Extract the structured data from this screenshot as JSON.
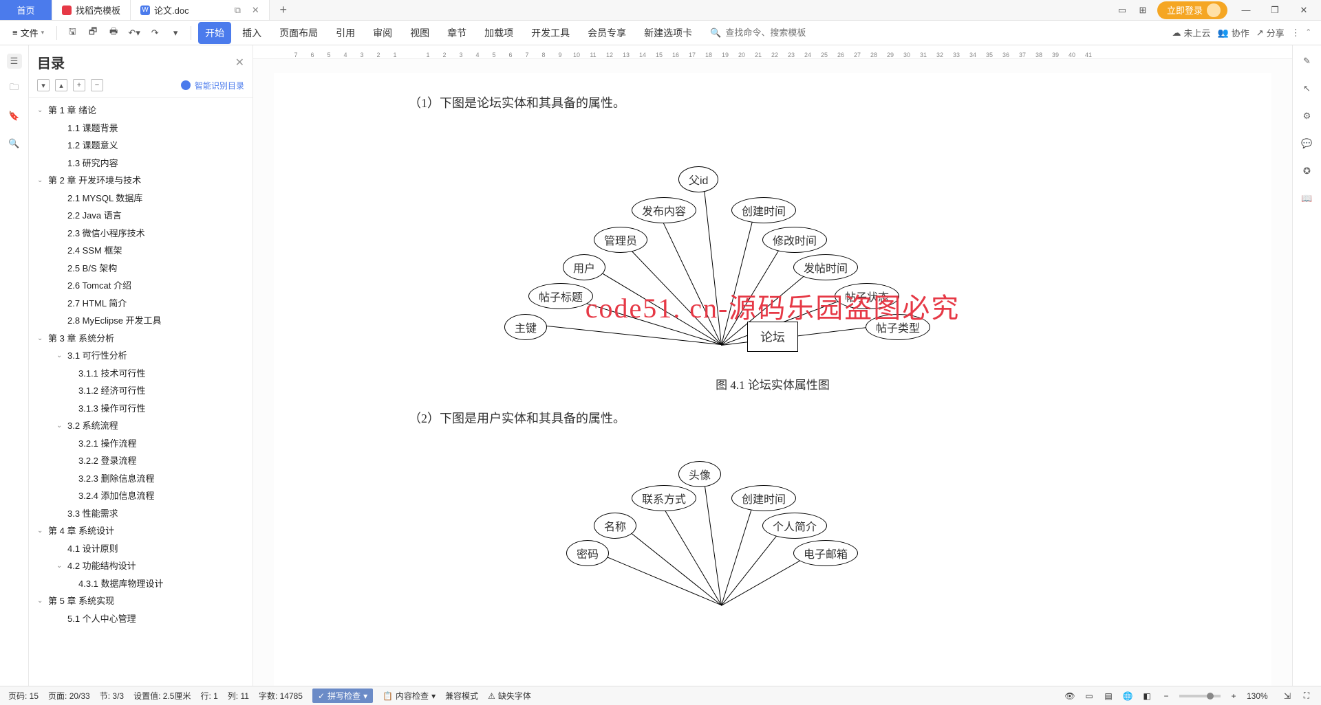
{
  "titlebar": {
    "home": "首页",
    "template_tab": "找稻壳模板",
    "doc_tab": "论文.doc",
    "login": "立即登录"
  },
  "toolbar": {
    "file_menu": "文件",
    "ribbon": [
      "开始",
      "插入",
      "页面布局",
      "引用",
      "审阅",
      "视图",
      "章节",
      "加载项",
      "开发工具",
      "会员专享",
      "新建选项卡"
    ],
    "search_placeholder": "查找命令、搜索模板",
    "cloud": "未上云",
    "collab": "协作",
    "share": "分享"
  },
  "outline": {
    "title": "目录",
    "smart": "智能识别目录",
    "items": [
      {
        "level": 1,
        "chev": true,
        "text": "第 1 章  绪论"
      },
      {
        "level": 2,
        "text": "1.1  课题背景"
      },
      {
        "level": 2,
        "text": "1.2  课题意义"
      },
      {
        "level": 2,
        "text": "1.3  研究内容"
      },
      {
        "level": 1,
        "chev": true,
        "text": "第 2 章  开发环境与技术"
      },
      {
        "level": 2,
        "text": "2.1  MYSQL 数据库"
      },
      {
        "level": 2,
        "text": "2.2  Java 语言"
      },
      {
        "level": 2,
        "text": "2.3  微信小程序技术"
      },
      {
        "level": 2,
        "text": "2.4  SSM 框架"
      },
      {
        "level": 2,
        "text": "2.5  B/S 架构"
      },
      {
        "level": 2,
        "text": "2.6  Tomcat  介绍"
      },
      {
        "level": 2,
        "text": "2.7  HTML 简介"
      },
      {
        "level": 2,
        "text": "2.8  MyEclipse 开发工具"
      },
      {
        "level": 1,
        "chev": true,
        "text": "第 3 章  系统分析"
      },
      {
        "level": 2,
        "chev": true,
        "text": "3.1  可行性分析"
      },
      {
        "level": 3,
        "text": "3.1.1  技术可行性"
      },
      {
        "level": 3,
        "text": "3.1.2  经济可行性"
      },
      {
        "level": 3,
        "text": "3.1.3  操作可行性"
      },
      {
        "level": 2,
        "chev": true,
        "text": "3.2  系统流程"
      },
      {
        "level": 3,
        "text": "3.2.1  操作流程"
      },
      {
        "level": 3,
        "text": "3.2.2  登录流程"
      },
      {
        "level": 3,
        "text": "3.2.3  删除信息流程"
      },
      {
        "level": 3,
        "text": "3.2.4  添加信息流程"
      },
      {
        "level": 2,
        "text": "3.3  性能需求"
      },
      {
        "level": 1,
        "chev": true,
        "text": "第 4 章  系统设计"
      },
      {
        "level": 2,
        "text": "4.1  设计原则"
      },
      {
        "level": 2,
        "chev": true,
        "text": "4.2  功能结构设计"
      },
      {
        "level": 3,
        "text": "4.3.1  数据库物理设计"
      },
      {
        "level": 1,
        "chev": true,
        "text": "第 5 章  系统实现"
      },
      {
        "level": 2,
        "text": "5.1 个人中心管理"
      }
    ]
  },
  "ruler": [
    "7",
    "6",
    "5",
    "4",
    "3",
    "2",
    "1",
    "",
    "1",
    "2",
    "3",
    "4",
    "5",
    "6",
    "7",
    "8",
    "9",
    "10",
    "11",
    "12",
    "13",
    "14",
    "15",
    "16",
    "17",
    "18",
    "19",
    "20",
    "21",
    "22",
    "23",
    "24",
    "25",
    "26",
    "27",
    "28",
    "29",
    "30",
    "31",
    "32",
    "33",
    "34",
    "35",
    "36",
    "37",
    "38",
    "39",
    "40",
    "41"
  ],
  "page": {
    "intro1": "（1）下图是论坛实体和其具备的属性。",
    "forum_entity": "论坛",
    "forum_attrs": [
      "主键",
      "帖子标题",
      "用户",
      "管理员",
      "发布内容",
      "父id",
      "创建时间",
      "修改时间",
      "发帖时间",
      "帖子状态",
      "帖子类型"
    ],
    "caption1": "图 4.1 论坛实体属性图",
    "intro2": "（2）下图是用户实体和其具备的属性。",
    "user_attrs": [
      "密码",
      "名称",
      "联系方式",
      "头像",
      "创建时间",
      "个人简介",
      "电子邮箱"
    ],
    "watermark": "code51. cn-源码乐园盗图必究"
  },
  "statusbar": {
    "page_no": "页码: 15",
    "page": "页面: 20/33",
    "section": "节: 3/3",
    "setval": "设置值: 2.5厘米",
    "row": "行: 1",
    "col": "列: 11",
    "words": "字数: 14785",
    "spellcheck": "拼写检查",
    "content_check": "内容检查",
    "compat": "兼容模式",
    "missing_font": "缺失字体",
    "zoom": "130%"
  }
}
